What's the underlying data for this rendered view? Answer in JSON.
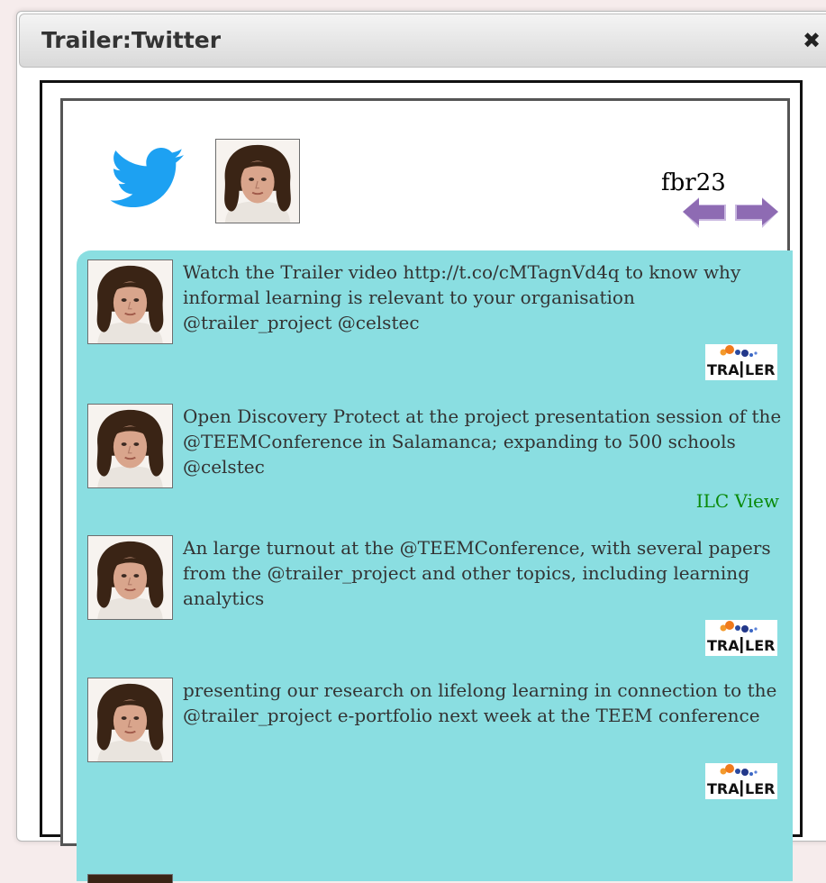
{
  "window": {
    "title": "Trailer:Twitter",
    "close_glyph": "✖"
  },
  "header": {
    "logo_icon": "twitter-bird-icon",
    "username": "fbr23",
    "nav": [
      "arrow-left-icon",
      "arrow-right-icon"
    ]
  },
  "tweets": [
    {
      "text": "Watch the Trailer video http://t.co/cMTagnVd4q to know why informal learning is relevant to your organisation @trailer_project @celstec",
      "badge_type": "logo",
      "badge_label": "TRAILER"
    },
    {
      "text": "Open Discovery Protect at the project presentation session of the @TEEMConference in Salamanca; expanding to 500 schools @celstec",
      "badge_type": "text",
      "badge_label": "ILC View"
    },
    {
      "text": "An large turnout at the @TEEMConference, with several papers from the @trailer_project and other topics, including learning analytics",
      "badge_type": "logo",
      "badge_label": "TRAILER"
    },
    {
      "text": "presenting our research on lifelong learning in connection to the @trailer_project e-portfolio next week at the TEEM conference",
      "badge_type": "logo",
      "badge_label": "TRAILER"
    }
  ],
  "colors": {
    "feed_background": "#8adee1",
    "twitter_blue": "#1da1f2",
    "arrow_purple": "#8e6bb3",
    "ilc_green": "#0a8a0a"
  }
}
